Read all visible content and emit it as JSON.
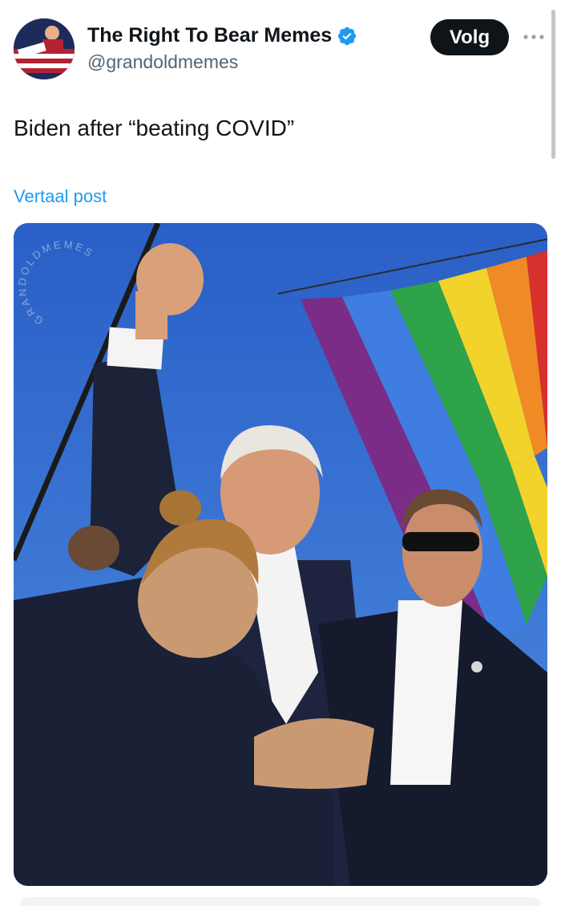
{
  "user": {
    "display_name": "The Right To Bear Memes",
    "handle": "@grandoldmemes",
    "verified": true,
    "avatar_icon": "avatar-icon"
  },
  "actions": {
    "follow_label": "Volg",
    "more_icon": "more-icon"
  },
  "tweet": {
    "text": "Biden after “beating COVID”",
    "translate_label": "Vertaal post"
  },
  "media": {
    "type": "photo",
    "watermark": "GRANDOLDMEMES"
  },
  "colors": {
    "link": "#1d9bf0",
    "verified": "#1d9bf0",
    "follow_bg": "#0f1419",
    "text": "#0f1419",
    "secondary": "#536471"
  }
}
